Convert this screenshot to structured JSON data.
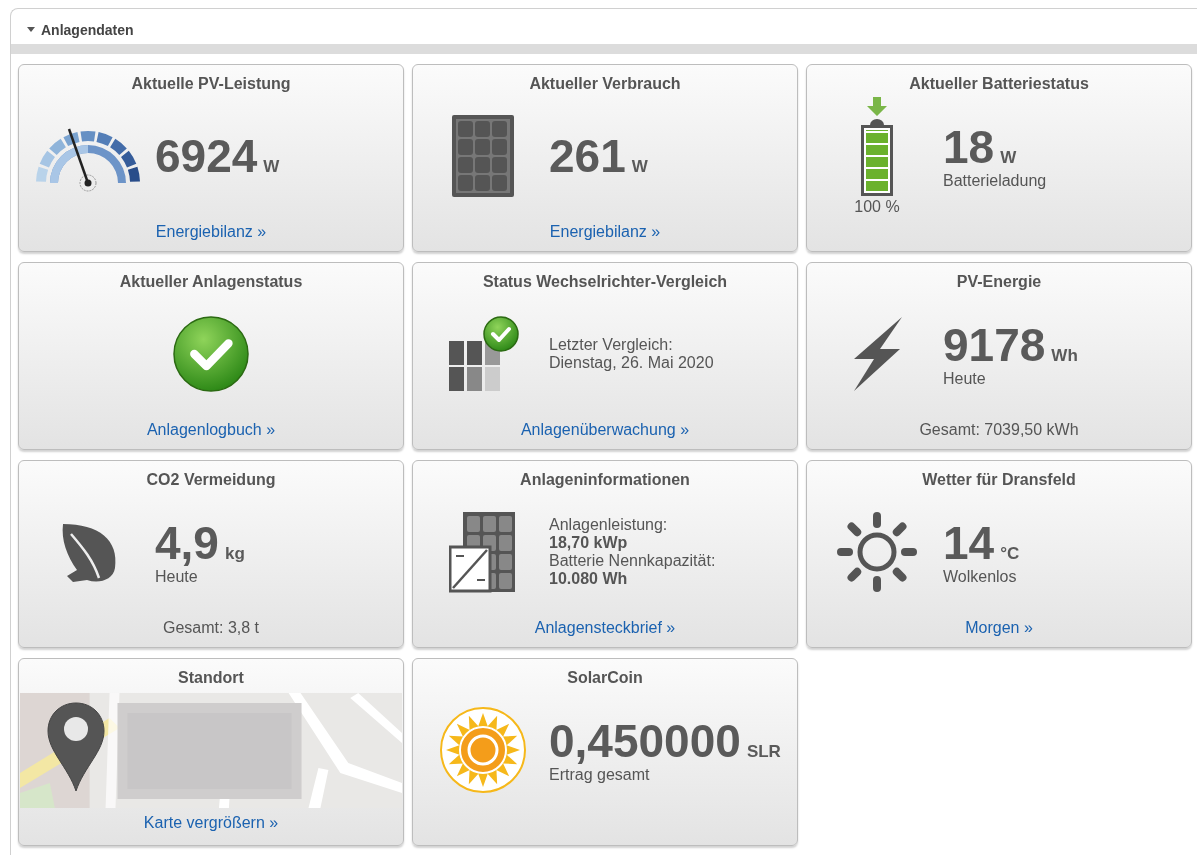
{
  "section": {
    "title": "Anlagendaten",
    "expanded": true
  },
  "tiles": [
    {
      "kind": "pv_power",
      "title": "Aktuelle PV-Leistung",
      "value": "6924",
      "unit": "W",
      "footer": {
        "kind": "link",
        "text": "Energiebilanz »"
      }
    },
    {
      "kind": "consumption",
      "title": "Aktueller Verbrauch",
      "value": "261",
      "unit": "W",
      "footer": {
        "kind": "link",
        "text": "Energiebilanz »"
      }
    },
    {
      "kind": "battery",
      "title": "Aktueller Batteriestatus",
      "value": "18",
      "unit": "W",
      "caption": "Batterieladung",
      "level": 1,
      "reading": "100 %"
    },
    {
      "kind": "plant_status",
      "title": "Aktueller Anlagenstatus",
      "footer": {
        "kind": "link",
        "text": "Anlagenlogbuch »"
      }
    },
    {
      "kind": "inverter_check",
      "title": "Status Wechselrichter-Vergleich",
      "lines": [
        {
          "text": "Letzter Vergleich:",
          "bold": false
        },
        {
          "text": "Dienstag, 26. Mai 2020",
          "bold": false
        }
      ],
      "footer": {
        "kind": "link",
        "text": "Anlagenüberwachung »"
      }
    },
    {
      "kind": "pv_energy",
      "title": "PV-Energie",
      "value": "9178",
      "unit": "Wh",
      "caption": "Heute",
      "footer": {
        "kind": "text",
        "text": "Gesamt: 7039,50 kWh"
      }
    },
    {
      "kind": "co2",
      "title": "CO2 Vermeidung",
      "value": "4,9",
      "unit": "kg",
      "caption": "Heute",
      "footer": {
        "kind": "text",
        "text": "Gesamt: 3,8 t"
      }
    },
    {
      "kind": "plant_info",
      "title": "Anlageninformationen",
      "lines": [
        {
          "text": "Anlagenleistung:",
          "bold": false
        },
        {
          "text": "18,70 kWp",
          "bold": true
        },
        {
          "text": "Batterie Nennkapazität:",
          "bold": false
        },
        {
          "text": "10.080 Wh",
          "bold": true
        }
      ],
      "footer": {
        "kind": "link",
        "text": "Anlagensteckbrief »"
      }
    },
    {
      "kind": "weather",
      "title": "Wetter für Dransfeld",
      "value": "14",
      "unit": "°C",
      "caption": "Wolkenlos",
      "footer": {
        "kind": "link",
        "text": "Morgen »"
      }
    },
    {
      "kind": "location",
      "title": "Standort",
      "footer": {
        "kind": "link",
        "text": "Karte vergrößern »"
      }
    },
    {
      "kind": "solarcoin",
      "title": "SolarCoin",
      "value": "0,450000",
      "unit": "SLR",
      "caption": "Ertrag gesamt"
    }
  ]
}
